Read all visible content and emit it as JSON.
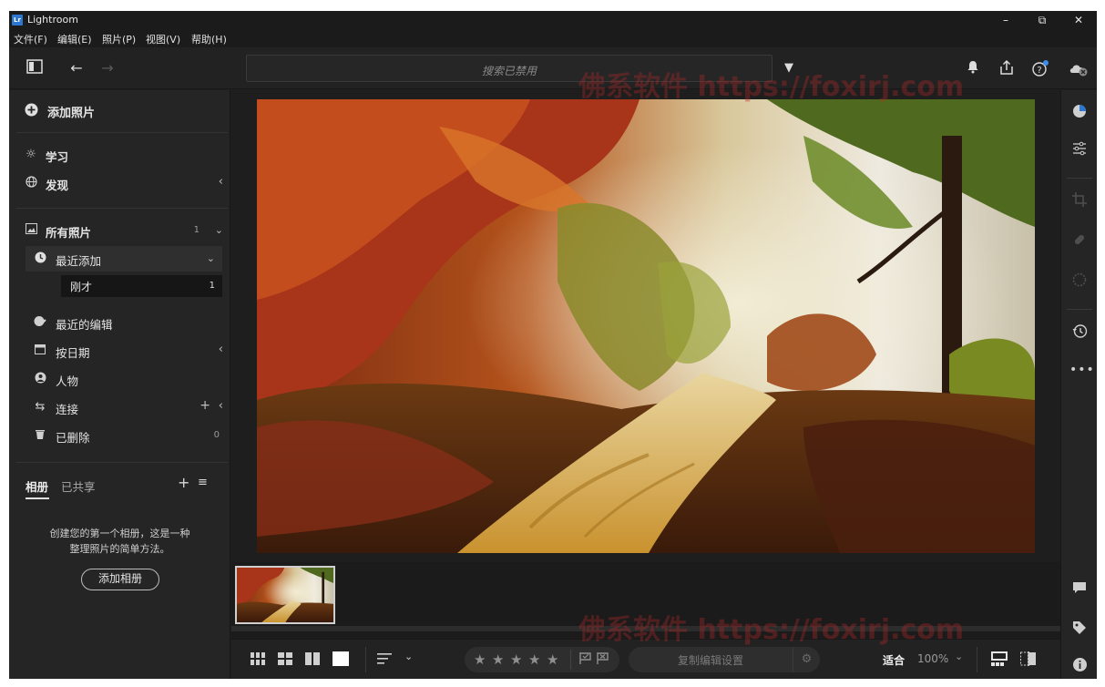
{
  "window": {
    "title": "Lightroom",
    "logo_text": "Lr",
    "minimize": "–",
    "maximize": "⧉",
    "close": "✕"
  },
  "menu": [
    "文件(F)",
    "编辑(E)",
    "照片(P)",
    "视图(V)",
    "帮助(H)"
  ],
  "toolbar": {
    "search_placeholder": "搜索已禁用"
  },
  "left_panel": {
    "add_photos": "添加照片",
    "learn": "学习",
    "discover": "发现",
    "all_photos": {
      "label": "所有照片",
      "count": "1"
    },
    "recently_added": "最近添加",
    "just_now": {
      "label": "刚才",
      "count": "1"
    },
    "recent_edits": "最近的编辑",
    "by_date": "按日期",
    "people": "人物",
    "connections": "连接",
    "deleted": {
      "label": "已删除",
      "count": "0"
    },
    "tabs": {
      "albums": "相册",
      "shared": "已共享"
    },
    "empty_text_1": "创建您的第一个相册，这是一种",
    "empty_text_2": "整理照片的简单方法。",
    "create_album": "添加相册"
  },
  "bottom_bar": {
    "copy_settings": "复制编辑设置",
    "fit": "适合",
    "zoom": "100%",
    "rating": 0
  },
  "watermark": "佛系软件 https://foxirj.com",
  "colors": {
    "accent": "#2b77d2",
    "notification": "#3a8ee6"
  }
}
